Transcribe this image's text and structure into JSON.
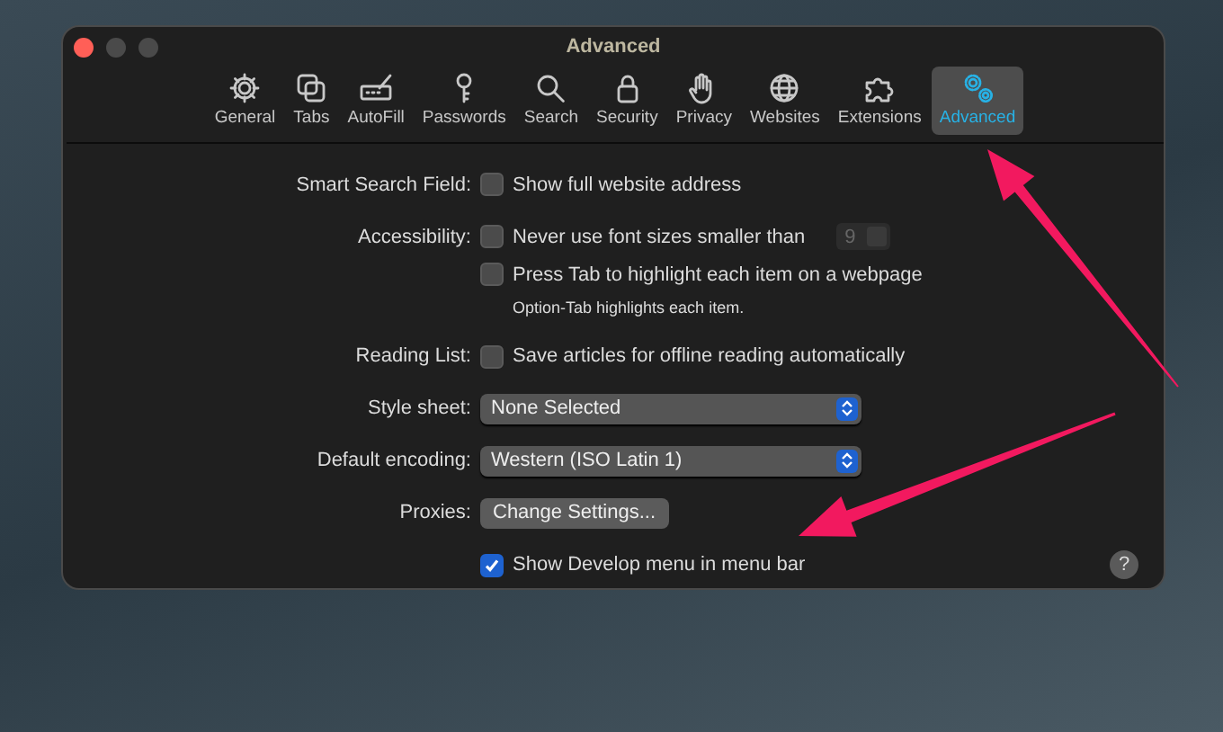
{
  "window": {
    "title": "Advanced"
  },
  "toolbar": [
    {
      "label": "General",
      "kind": "gear",
      "selected": false
    },
    {
      "label": "Tabs",
      "kind": "tabs",
      "selected": false
    },
    {
      "label": "AutoFill",
      "kind": "autofill",
      "selected": false
    },
    {
      "label": "Passwords",
      "kind": "key",
      "selected": false
    },
    {
      "label": "Search",
      "kind": "search",
      "selected": false
    },
    {
      "label": "Security",
      "kind": "lock",
      "selected": false
    },
    {
      "label": "Privacy",
      "kind": "hand",
      "selected": false
    },
    {
      "label": "Websites",
      "kind": "globe",
      "selected": false
    },
    {
      "label": "Extensions",
      "kind": "puzzle",
      "selected": false
    },
    {
      "label": "Advanced",
      "kind": "gears",
      "selected": true
    }
  ],
  "settings": [
    {
      "label": "Smart Search Field:",
      "controls": [
        {
          "kind": "checkbox",
          "text": "Show full website address",
          "checked": false
        }
      ]
    },
    {
      "label": "Accessibility:",
      "controls": [
        {
          "kind": "checkbox",
          "text": "Never use font sizes smaller than",
          "checked": false,
          "popup": {
            "value": "9",
            "disabled": true
          }
        },
        {
          "kind": "checkbox",
          "text": "Press Tab to highlight each item on a webpage",
          "checked": false
        },
        {
          "kind": "note",
          "text": "Option-Tab highlights each item."
        }
      ]
    },
    {
      "label": "Reading List:",
      "controls": [
        {
          "kind": "checkbox",
          "text": "Save articles for offline reading automatically",
          "checked": false
        }
      ]
    },
    {
      "label": "Style sheet:",
      "controls": [
        {
          "kind": "select",
          "value": "None Selected"
        }
      ]
    },
    {
      "label": "Default encoding:",
      "controls": [
        {
          "kind": "select",
          "value": "Western (ISO Latin 1)"
        }
      ]
    },
    {
      "label": "Proxies:",
      "controls": [
        {
          "kind": "button",
          "text": "Change Settings..."
        }
      ]
    },
    {
      "controls": [
        {
          "kind": "checkbox",
          "text": "Show Develop menu in menu bar",
          "checked": true
        }
      ]
    }
  ],
  "help_button": {
    "text": "?"
  }
}
